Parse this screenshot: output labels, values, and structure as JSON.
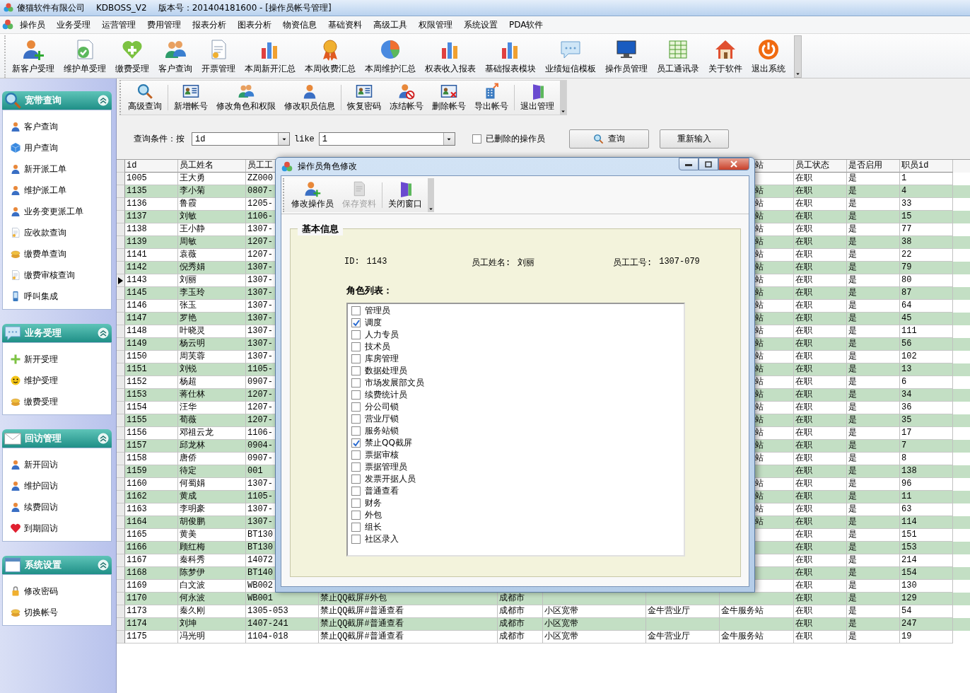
{
  "window": {
    "app_name": "傻猫软件有限公司",
    "product": "KDBOSS_V2",
    "version": "版本号：201404181600 - [操作员帐号管理]"
  },
  "menu": [
    "操作员",
    "业务受理",
    "运营管理",
    "费用管理",
    "报表分析",
    "图表分析",
    "物资信息",
    "基础资料",
    "高级工具",
    "权限管理",
    "系统设置",
    "PDA软件"
  ],
  "toolbar": [
    "新客户受理",
    "维护单受理",
    "缴费受理",
    "客户查询",
    "开票管理",
    "本周新开汇总",
    "本周收费汇总",
    "本周维护汇总",
    "权表收入报表",
    "基础报表模块",
    "业绩短信模板",
    "操作员管理",
    "员工通讯录",
    "关于软件",
    "退出系统"
  ],
  "sidebar": {
    "sections": [
      {
        "title": "宽带查询",
        "items": [
          "客户查询",
          "用户查询",
          "新开派工单",
          "维护派工单",
          "业务变更派工单",
          "应收款查询",
          "缴费单查询",
          "缴费审核查询",
          "呼叫集成"
        ]
      },
      {
        "title": "业务受理",
        "items": [
          "新开受理",
          "维护受理",
          "缴费受理"
        ]
      },
      {
        "title": "回访管理",
        "items": [
          "新开回访",
          "维护回访",
          "续费回访",
          "到期回访"
        ]
      },
      {
        "title": "系统设置",
        "items": [
          "修改密码",
          "切换帐号"
        ]
      }
    ]
  },
  "sub_toolbar": [
    "高级查询",
    "新增帐号",
    "修改角色和权限",
    "修改职员信息",
    "恢复密码",
    "冻结帐号",
    "删除帐号",
    "导出帐号",
    "退出管理"
  ],
  "query": {
    "label": "查询条件：按",
    "field": "id",
    "operator": "like",
    "value": "1",
    "deleted_checkbox": {
      "label": "已删除的操作员",
      "checked": false
    },
    "buttons": [
      "查询",
      "重新输入"
    ]
  },
  "table": {
    "header": {
      "id": "id",
      "name": "员工姓名",
      "job_no": "员工工",
      "column_8": "站",
      "status": "员工状态",
      "enabled": "是否启用",
      "staff_id": "职员id"
    },
    "rows": [
      {
        "id": "1005",
        "name": "王大勇",
        "job_no": "ZZ000",
        "status": "在职",
        "enabled": "是",
        "staff_id": "1",
        "selected": false
      },
      {
        "id": "1135",
        "name": "李小菊",
        "job_no": "0807-",
        "column_8": "站",
        "status": "在职",
        "enabled": "是",
        "staff_id": "4",
        "selected": false
      },
      {
        "id": "1136",
        "name": "鲁霞",
        "job_no": "1205-",
        "column_8": "站",
        "status": "在职",
        "enabled": "是",
        "staff_id": "33",
        "selected": false
      },
      {
        "id": "1137",
        "name": "刘敏",
        "job_no": "1106-",
        "column_8": "站",
        "status": "在职",
        "enabled": "是",
        "staff_id": "15",
        "selected": false
      },
      {
        "id": "1138",
        "name": "王小静",
        "job_no": "1307-",
        "column_8": "站",
        "status": "在职",
        "enabled": "是",
        "staff_id": "77",
        "selected": false
      },
      {
        "id": "1139",
        "name": "周敏",
        "job_no": "1207-",
        "column_8": "站",
        "status": "在职",
        "enabled": "是",
        "staff_id": "38",
        "selected": false
      },
      {
        "id": "1141",
        "name": "袁薇",
        "job_no": "1207-",
        "column_8": "站",
        "status": "在职",
        "enabled": "是",
        "staff_id": "22",
        "selected": false
      },
      {
        "id": "1142",
        "name": "倪秀娟",
        "job_no": "1307-",
        "column_8": "站",
        "status": "在职",
        "enabled": "是",
        "staff_id": "79",
        "selected": false
      },
      {
        "id": "1143",
        "name": "刘丽",
        "job_no": "1307-",
        "column_8": "站",
        "status": "在职",
        "enabled": "是",
        "staff_id": "80",
        "selected": true
      },
      {
        "id": "1145",
        "name": "李玉玲",
        "job_no": "1307-",
        "column_8": "站",
        "status": "在职",
        "enabled": "是",
        "staff_id": "87",
        "selected": false
      },
      {
        "id": "1146",
        "name": "张玉",
        "job_no": "1307-",
        "column_8": "站",
        "status": "在职",
        "enabled": "是",
        "staff_id": "64",
        "selected": false
      },
      {
        "id": "1147",
        "name": "罗艳",
        "job_no": "1307-",
        "column_8": "站",
        "status": "在职",
        "enabled": "是",
        "staff_id": "45",
        "selected": false
      },
      {
        "id": "1148",
        "name": "叶晓灵",
        "job_no": "1307-",
        "column_8": "站",
        "status": "在职",
        "enabled": "是",
        "staff_id": "111",
        "selected": false
      },
      {
        "id": "1149",
        "name": "杨云明",
        "job_no": "1307-",
        "column_8": "站",
        "status": "在职",
        "enabled": "是",
        "staff_id": "56",
        "selected": false
      },
      {
        "id": "1150",
        "name": "周芙蓉",
        "job_no": "1307-",
        "column_8": "站",
        "status": "在职",
        "enabled": "是",
        "staff_id": "102",
        "selected": false
      },
      {
        "id": "1151",
        "name": "刘锐",
        "job_no": "1105-",
        "column_8": "站",
        "status": "在职",
        "enabled": "是",
        "staff_id": "13",
        "selected": false
      },
      {
        "id": "1152",
        "name": "杨超",
        "job_no": "0907-",
        "column_8": "站",
        "status": "在职",
        "enabled": "是",
        "staff_id": "6",
        "selected": false
      },
      {
        "id": "1153",
        "name": "蒋仕林",
        "job_no": "1207-",
        "column_8": "站",
        "status": "在职",
        "enabled": "是",
        "staff_id": "34",
        "selected": false
      },
      {
        "id": "1154",
        "name": "汪华",
        "job_no": "1207-",
        "column_8": "站",
        "status": "在职",
        "enabled": "是",
        "staff_id": "36",
        "selected": false
      },
      {
        "id": "1155",
        "name": "荀薇",
        "job_no": "1207-",
        "column_8": "站",
        "status": "在职",
        "enabled": "是",
        "staff_id": "35",
        "selected": false
      },
      {
        "id": "1156",
        "name": "邓祖云龙",
        "job_no": "1106-",
        "column_8": "站",
        "status": "在职",
        "enabled": "是",
        "staff_id": "17",
        "selected": false
      },
      {
        "id": "1157",
        "name": "邱龙林",
        "job_no": "0904-",
        "column_8": "站",
        "status": "在职",
        "enabled": "是",
        "staff_id": "7",
        "selected": false
      },
      {
        "id": "1158",
        "name": "唐侨",
        "job_no": "0907-",
        "column_8": "站",
        "status": "在职",
        "enabled": "是",
        "staff_id": "8",
        "selected": false
      },
      {
        "id": "1159",
        "name": "待定",
        "job_no": "001",
        "status": "在职",
        "enabled": "是",
        "staff_id": "138",
        "selected": false
      },
      {
        "id": "1160",
        "name": "何蜀娟",
        "job_no": "1307-",
        "column_8": "站",
        "status": "在职",
        "enabled": "是",
        "staff_id": "96",
        "selected": false
      },
      {
        "id": "1162",
        "name": "黄成",
        "job_no": "1105-",
        "column_8": "站",
        "status": "在职",
        "enabled": "是",
        "staff_id": "11",
        "selected": false
      },
      {
        "id": "1163",
        "name": "李明豪",
        "job_no": "1307-",
        "column_8": "站",
        "status": "在职",
        "enabled": "是",
        "staff_id": "63",
        "selected": false
      },
      {
        "id": "1164",
        "name": "胡俊鹏",
        "job_no": "1307-",
        "column_8": "站",
        "status": "在职",
        "enabled": "是",
        "staff_id": "114",
        "selected": false
      },
      {
        "id": "1165",
        "name": "黄美",
        "job_no": "BT130",
        "status": "在职",
        "enabled": "是",
        "staff_id": "151",
        "selected": false
      },
      {
        "id": "1166",
        "name": "顾红梅",
        "job_no": "BT130",
        "status": "在职",
        "enabled": "是",
        "staff_id": "153",
        "selected": false
      },
      {
        "id": "1167",
        "name": "秦科秀",
        "job_no": "14072",
        "status": "在职",
        "enabled": "是",
        "staff_id": "214",
        "selected": false
      },
      {
        "id": "1168",
        "name": "陈梦伊",
        "job_no": "BT140",
        "status": "在职",
        "enabled": "是",
        "staff_id": "154",
        "selected": false
      },
      {
        "id": "1169",
        "name": "白文波",
        "job_no": "WB002",
        "status": "在职",
        "enabled": "是",
        "staff_id": "130",
        "selected": false
      },
      {
        "id": "1170",
        "name": "何永波",
        "job_no": "WB001",
        "roles": "禁止QQ截屏#外包",
        "city": "成都市",
        "status": "在职",
        "enabled": "是",
        "staff_id": "129",
        "selected": false
      },
      {
        "id": "1173",
        "name": "秦久刚",
        "job_no": "1305-053",
        "roles": "禁止QQ截屏#普通查看",
        "city": "成都市",
        "column_6": "小区宽带",
        "column_7": "金牛营业厅",
        "column_8": "金牛服务站",
        "status": "在职",
        "enabled": "是",
        "staff_id": "54",
        "selected": false
      },
      {
        "id": "1174",
        "name": "刘坤",
        "job_no": "1407-241",
        "roles": "禁止QQ截屏#普通查看",
        "city": "成都市",
        "column_6": "小区宽带",
        "status": "在职",
        "enabled": "是",
        "staff_id": "247",
        "selected": false
      },
      {
        "id": "1175",
        "name": "冯光明",
        "job_no": "1104-018",
        "roles": "禁止QQ截屏#普通查看",
        "city": "成都市",
        "column_6": "小区宽带",
        "column_7": "金牛营业厅",
        "column_8": "金牛服务站",
        "status": "在职",
        "enabled": "是",
        "staff_id": "19",
        "selected": false
      }
    ]
  },
  "dialog": {
    "title": "操作员角色修改",
    "toolbar": [
      {
        "label": "修改操作员",
        "disabled": false
      },
      {
        "label": "保存资料",
        "disabled": true
      },
      {
        "label": "关闭窗口",
        "disabled": false
      }
    ],
    "group_title": "基本信息",
    "fields": [
      {
        "label": "ID:",
        "value": "1143"
      },
      {
        "label": "员工姓名:",
        "value": "刘丽"
      },
      {
        "label": "员工工号:",
        "value": "1307-079"
      }
    ],
    "roles_label": "角色列表：",
    "roles": [
      {
        "label": "管理员",
        "checked": false
      },
      {
        "label": "调度",
        "checked": true
      },
      {
        "label": "人力专员",
        "checked": false
      },
      {
        "label": "技术员",
        "checked": false
      },
      {
        "label": "库房管理",
        "checked": false
      },
      {
        "label": "数据处理员",
        "checked": false
      },
      {
        "label": "市场发展部文员",
        "checked": false
      },
      {
        "label": "续费统计员",
        "checked": false
      },
      {
        "label": "分公司锁",
        "checked": false
      },
      {
        "label": "营业厅锁",
        "checked": false
      },
      {
        "label": "服务站锁",
        "checked": false
      },
      {
        "label": "禁止QQ截屏",
        "checked": true
      },
      {
        "label": "票据审核",
        "checked": false
      },
      {
        "label": "票据管理员",
        "checked": false
      },
      {
        "label": "发票开据人员",
        "checked": false
      },
      {
        "label": "普通查看",
        "checked": false
      },
      {
        "label": "财务",
        "checked": false
      },
      {
        "label": "外包",
        "checked": false
      },
      {
        "label": "组长",
        "checked": false
      },
      {
        "label": "社区录入",
        "checked": false
      }
    ]
  }
}
